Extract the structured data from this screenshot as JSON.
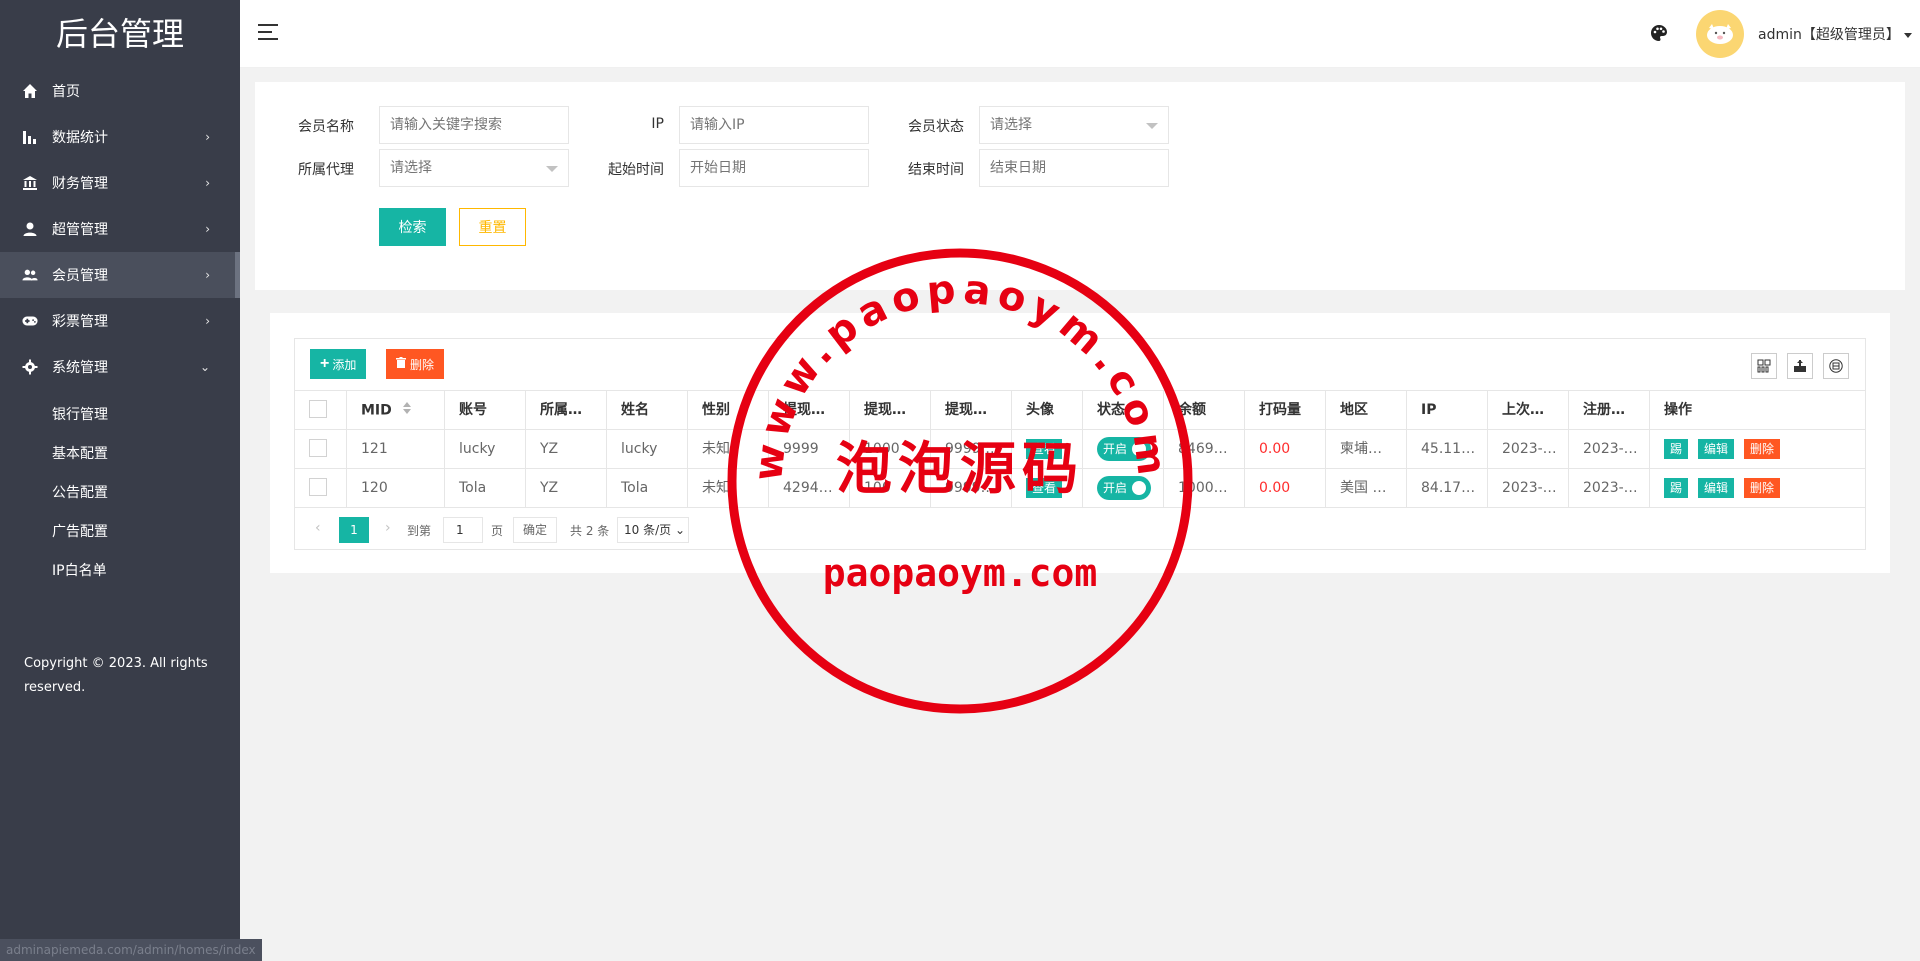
{
  "sidebar": {
    "logo": "后台管理",
    "items": [
      {
        "label": "首页",
        "icon": "home-icon"
      },
      {
        "label": "数据统计",
        "icon": "bar-chart-icon"
      },
      {
        "label": "财务管理",
        "icon": "bank-icon"
      },
      {
        "label": "超管管理",
        "icon": "user-icon"
      },
      {
        "label": "会员管理",
        "icon": "users-icon"
      },
      {
        "label": "彩票管理",
        "icon": "gamepad-icon"
      },
      {
        "label": "系统管理",
        "icon": "gear-icon"
      }
    ],
    "sub_items": [
      "银行管理",
      "基本配置",
      "公告配置",
      "广告配置",
      "IP白名单"
    ],
    "copyright": "Copyright © 2023. All rights reserved.",
    "status_url": "adminapiemeda.com/admin/homes/index"
  },
  "header": {
    "user": "admin【超级管理员】"
  },
  "search": {
    "member_name_label": "会员名称",
    "member_name_placeholder": "请输入关键字搜索",
    "ip_label": "IP",
    "ip_placeholder": "请输入IP",
    "status_label": "会员状态",
    "status_placeholder": "请选择",
    "agent_label": "所属代理",
    "agent_placeholder": "请选择",
    "start_label": "起始时间",
    "start_placeholder": "开始日期",
    "end_label": "结束时间",
    "end_placeholder": "结束日期",
    "search_button": "检索",
    "reset_button": "重置"
  },
  "toolbar": {
    "add_button": "添加",
    "delete_button": "删除"
  },
  "table": {
    "columns": [
      "MID",
      "账号",
      "所属…",
      "姓名",
      "性别",
      "提现…",
      "提现…",
      "提现…",
      "头像",
      "状态",
      "余额",
      "打码量",
      "地区",
      "IP",
      "上次…",
      "注册…",
      "操作"
    ],
    "rows": [
      {
        "mid": "121",
        "account": "lucky",
        "agent": "YZ",
        "name": "lucky",
        "gender": "未知",
        "w1": "9999",
        "w2": "1000",
        "w3": "9999…",
        "avatar_btn": "查看",
        "status": "开启",
        "balance": "8469…",
        "betting": "0.00",
        "region": "柬埔…",
        "ip": "45.11…",
        "last": "2023-…",
        "reg": "2023-…",
        "op1": "踢",
        "op2": "编辑",
        "op3": "删除"
      },
      {
        "mid": "120",
        "account": "Tola",
        "agent": "YZ",
        "name": "Tola",
        "gender": "未知",
        "w1": "4294…",
        "w2": "100",
        "w3": "9999…",
        "avatar_btn": "查看",
        "status": "开启",
        "balance": "1000…",
        "betting": "0.00",
        "region": "美国 …",
        "ip": "84.17…",
        "last": "2023-…",
        "reg": "2023-…",
        "op1": "踢",
        "op2": "编辑",
        "op3": "删除"
      }
    ]
  },
  "pager": {
    "current": "1",
    "goto_label": "到第",
    "page_input": "1",
    "page_unit": "页",
    "confirm": "确定",
    "total": "共 2 条",
    "per_page": "10 条/页"
  },
  "watermark": {
    "arc_text": "www.paopaoym.com",
    "center_text": "泡泡源码",
    "bottom_text": "paopaoym.com"
  }
}
